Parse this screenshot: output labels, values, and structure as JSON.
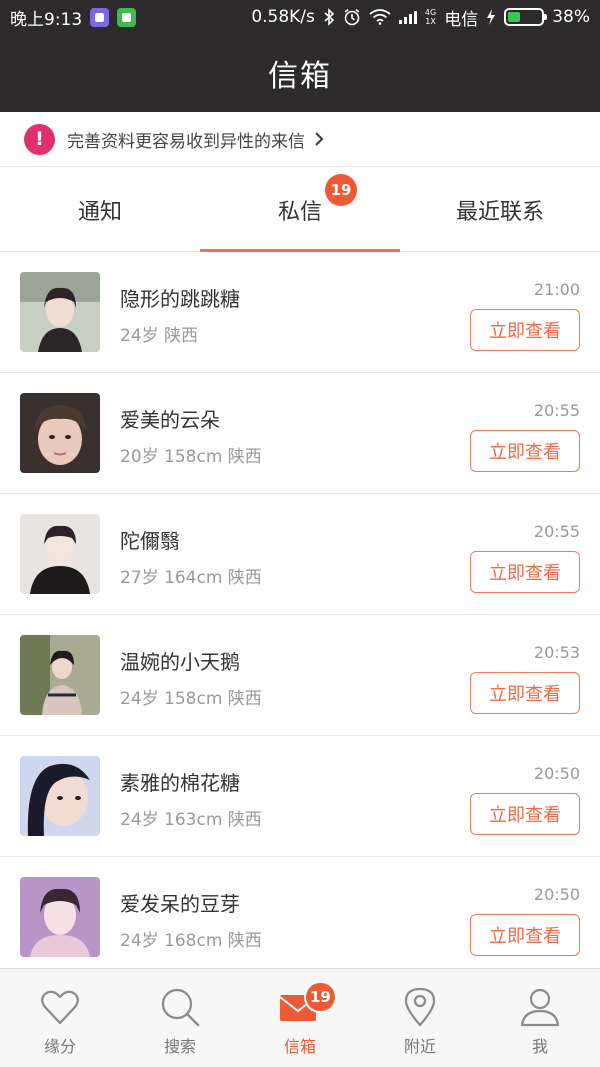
{
  "status_bar": {
    "time": "晚上9:13",
    "speed": "0.58K/s",
    "net_type_top": "4G",
    "net_type_bottom": "1X",
    "carrier": "电信",
    "battery_text": "38%",
    "battery_level": 0.38,
    "icons": [
      "app-icon-purple",
      "app-icon-green",
      "bluetooth-icon",
      "alarm-icon",
      "wifi-icon",
      "signal-icon",
      "charging-icon",
      "battery-icon"
    ]
  },
  "header": {
    "title": "信箱"
  },
  "notice": {
    "text": "完善资料更容易收到异性的来信",
    "icon": "exclamation-icon"
  },
  "tabs": [
    {
      "label": "通知",
      "active": false
    },
    {
      "label": "私信",
      "active": true,
      "badge": "19"
    },
    {
      "label": "最近联系",
      "active": false
    }
  ],
  "messages": [
    {
      "name": "隐形的跳跳糖",
      "meta": "24岁  陕西",
      "time": "21:00",
      "button": "立即查看"
    },
    {
      "name": "爱美的云朵",
      "meta": "20岁  158cm  陕西",
      "time": "20:55",
      "button": "立即查看"
    },
    {
      "name": "陀儞翳",
      "meta": "27岁  164cm  陕西",
      "time": "20:55",
      "button": "立即查看"
    },
    {
      "name": "温婉的小天鹅",
      "meta": "24岁  158cm  陕西",
      "time": "20:53",
      "button": "立即查看"
    },
    {
      "name": "素雅的棉花糖",
      "meta": "24岁  163cm  陕西",
      "time": "20:50",
      "button": "立即查看"
    },
    {
      "name": "爱发呆的豆芽",
      "meta": "24岁  168cm  陕西",
      "time": "20:50",
      "button": "立即查看"
    }
  ],
  "bottom_nav": [
    {
      "label": "缘分",
      "icon": "heart-icon",
      "active": false
    },
    {
      "label": "搜索",
      "icon": "search-icon",
      "active": false
    },
    {
      "label": "信箱",
      "icon": "mail-icon",
      "active": true,
      "badge": "19"
    },
    {
      "label": "附近",
      "icon": "location-pin-icon",
      "active": false
    },
    {
      "label": "我",
      "icon": "person-icon",
      "active": false
    }
  ],
  "colors": {
    "accent": "#ef5a34",
    "header_bg": "#2d2a2b",
    "notice_icon": "#e0306f"
  }
}
